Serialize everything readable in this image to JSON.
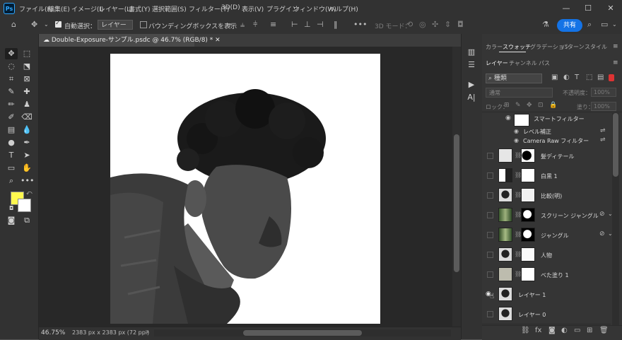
{
  "app": {
    "logo_text": "Ps"
  },
  "menu": [
    "ファイル(F)",
    "編集(E)",
    "イメージ(I)",
    "レイヤー(L)",
    "書式(Y)",
    "選択範囲(S)",
    "フィルター(T)",
    "3D(D)",
    "表示(V)",
    "プラグイン",
    "ウィンドウ(W)",
    "ヘルプ(H)"
  ],
  "window_controls": {
    "minimize": "—",
    "maximize": "☐",
    "close": "✕"
  },
  "options": {
    "auto_select_label": "自動選択：",
    "layer_select_value": "レイヤー",
    "bbox_label": "バウンディングボックスを表示",
    "mode_3d_label": "3D モード：",
    "share_label": "共有"
  },
  "document": {
    "tab_title": "Double-Exposure-サンプル.psdc @ 46.7% (RGB/8) *",
    "zoom": "46.75%",
    "size": "2383 px x 2383 px (72 ppi)"
  },
  "colors": {
    "foreground": "#fff84f",
    "background": "#ffffff",
    "accent": "#1473e6"
  },
  "panel": {
    "top_tabs": [
      "カラー",
      "スウォッチ",
      "グラデーション",
      "パターン",
      "スタイル"
    ],
    "active_top_tab": "スウォッチ",
    "layer_tabs": [
      "レイヤー",
      "チャンネル",
      "パス"
    ],
    "active_layer_tab": "レイヤー",
    "filter_value": "種類",
    "blend_mode": "通常",
    "opacity_label": "不透明度：",
    "opacity_value": "100%",
    "lock_label": "ロック：",
    "fill_label": "塗り：",
    "fill_value": "100%"
  },
  "smart_filters": {
    "header": "スマートフィルター",
    "items": [
      "レベル補正",
      "Camera Raw フィルター"
    ]
  },
  "layers": [
    {
      "name": "髪ディテール"
    },
    {
      "name": "白黒 1"
    },
    {
      "name": "比較(明)"
    },
    {
      "name": "スクリーン ジャングル"
    },
    {
      "name": "ジャングル"
    },
    {
      "name": "人物"
    },
    {
      "name": "べた塗り 1"
    },
    {
      "name": "レイヤー 1"
    },
    {
      "name": "レイヤー 0"
    }
  ]
}
